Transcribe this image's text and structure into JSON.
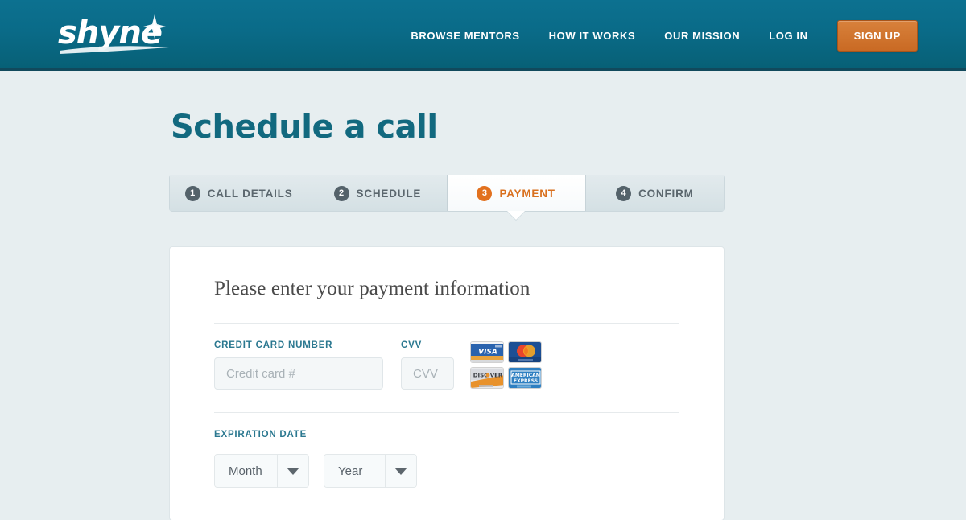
{
  "header": {
    "logo_text": "shyne",
    "logo_icon": "sparkle-icon",
    "nav": [
      {
        "label": "BROWSE MENTORS",
        "name": "browse-mentors"
      },
      {
        "label": "HOW IT WORKS",
        "name": "how-it-works"
      },
      {
        "label": "OUR MISSION",
        "name": "our-mission"
      },
      {
        "label": "LOG IN",
        "name": "log-in"
      }
    ],
    "signup_label": "SIGN UP",
    "bg_color": "#0a6b88",
    "signup_color": "#c96a24"
  },
  "page": {
    "title": "Schedule a call",
    "title_color": "#12697f",
    "background": "#e7eef0"
  },
  "steps": [
    {
      "number": "1",
      "label": "CALL DETAILS",
      "active": false
    },
    {
      "number": "2",
      "label": "SCHEDULE",
      "active": false
    },
    {
      "number": "3",
      "label": "PAYMENT",
      "active": true
    },
    {
      "number": "4",
      "label": "CONFIRM",
      "active": false
    }
  ],
  "step_active_color": "#d9711f",
  "form": {
    "heading": "Please enter your payment information",
    "credit_card": {
      "label": "CREDIT CARD NUMBER",
      "placeholder": "Credit card #",
      "value": ""
    },
    "cvv": {
      "label": "CVV",
      "placeholder": "CVV",
      "value": ""
    },
    "accepted_cards": [
      {
        "name": "visa-icon",
        "label": "VISA"
      },
      {
        "name": "mastercard-icon",
        "label": "MasterCard"
      },
      {
        "name": "discover-icon",
        "label": "DISCOVER"
      },
      {
        "name": "amex-icon",
        "label": "AMERICAN EXPRESS"
      }
    ],
    "expiration": {
      "label": "EXPIRATION DATE",
      "month": {
        "value": "Month"
      },
      "year": {
        "value": "Year"
      }
    },
    "label_color": "#2b7890"
  }
}
